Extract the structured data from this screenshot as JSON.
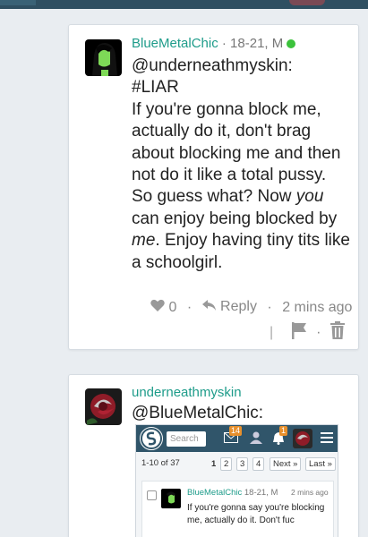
{
  "post1": {
    "username": "BlueMetalChic",
    "meta": " · 18-21, M",
    "mention": "@underneathmyskin:",
    "hashtag": "#LIAR",
    "body_part1": "If you're gonna block me, actually do it, don't brag about blocking me and then not do it like a total pussy. So guess what? Now ",
    "body_em1": "you",
    "body_part2": " can enjoy being blocked by ",
    "body_em2": "me",
    "body_part3": ". Enjoy having tiny tits like a schoolgirl.",
    "like_count": "0",
    "reply_label": "Reply",
    "time": "2 mins ago",
    "online_color": "#3cc23c"
  },
  "post2": {
    "username": "underneathmyskin",
    "mention": "@BlueMetalChic:"
  },
  "embed": {
    "search_placeholder": "Search",
    "mail_badge": "14",
    "bell_badge": "1",
    "range": "1-10 of 37",
    "pages": [
      "1",
      "2",
      "3",
      "4"
    ],
    "next_label": "Next »",
    "last_label": "Last »",
    "post_username": "BlueMetalChic",
    "post_meta": " 18-21, M",
    "post_time": "2 mins ago",
    "post_text": "If you're gonna say you're blocking me, actually do it. Don't fuc"
  },
  "colors": {
    "username": "#1e9c8a",
    "header": "#30556a",
    "badge": "#e8902c"
  }
}
